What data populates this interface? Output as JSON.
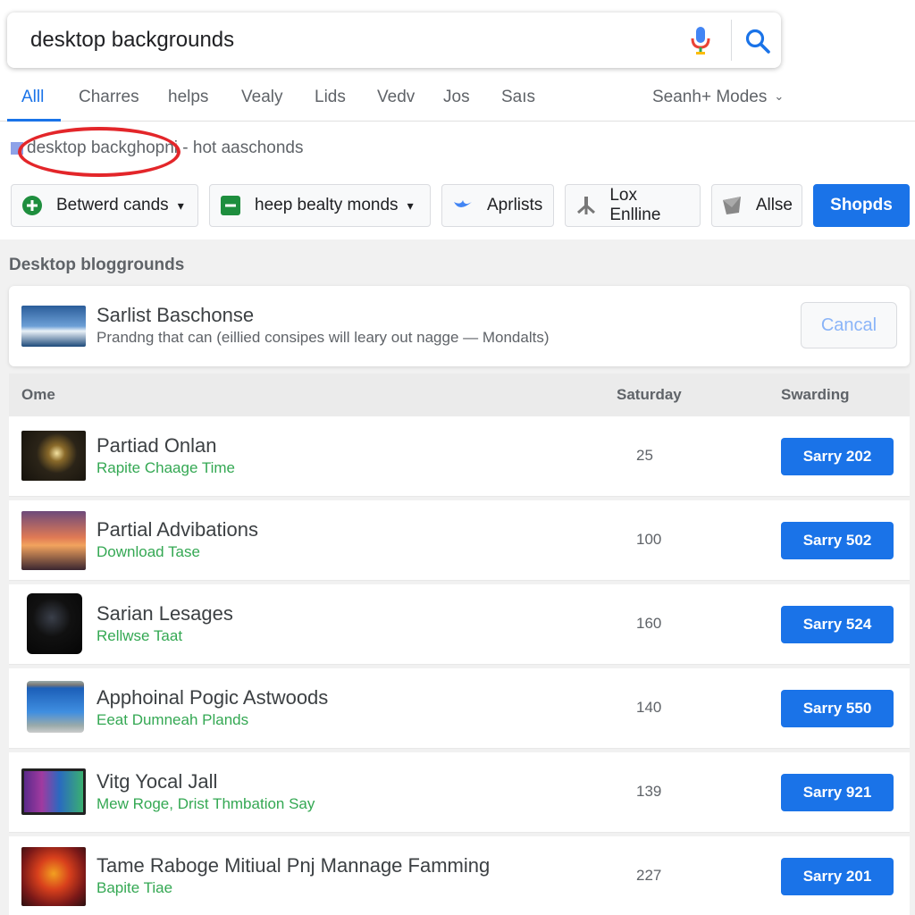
{
  "search": {
    "query": "desktop backgrounds",
    "mic_icon": "microphone-icon",
    "search_icon": "magnifier-icon"
  },
  "tabs": [
    {
      "label": "Alll",
      "active": true
    },
    {
      "label": "Charres"
    },
    {
      "label": "helps"
    },
    {
      "label": "Vealy"
    },
    {
      "label": "Lids"
    },
    {
      "label": "Vedv"
    },
    {
      "label": "Jos"
    },
    {
      "label": "Saıs"
    }
  ],
  "modes_label": "Seanh+ Modes",
  "suggestion": {
    "text": "desktop backghopni - hot aaschonds",
    "highlight_color": "#e3262a"
  },
  "chips": [
    {
      "label": "Betwerd cands",
      "icon": "plus-circle-icon",
      "dropdown": true
    },
    {
      "label": "heep bealty monds",
      "icon": "minus-square-icon",
      "dropdown": true
    },
    {
      "label": "Aprlists",
      "icon": "bird-icon"
    },
    {
      "label": "Lox Enlline",
      "icon": "tripod-icon"
    },
    {
      "label": "Allse",
      "icon": "flag-icon"
    },
    {
      "label": "Shopds",
      "primary": true
    }
  ],
  "section_title": "Desktop bloggrounds",
  "info_card": {
    "title": "Sarlist Baschonse",
    "subtitle": "Prandng that can (eillied consipes will leary out nagge — Mondalts)",
    "cancel_label": "Cancal"
  },
  "table": {
    "headers": [
      "Ome",
      "Saturday",
      "Swarding"
    ],
    "rows": [
      {
        "title": "Partiad Onlan",
        "subtitle": "Rapite Chaage Time",
        "value": "25",
        "button": "Sarry 202"
      },
      {
        "title": "Partial Advibations",
        "subtitle": "Download Tase",
        "value": "100",
        "button": "Sarry 502"
      },
      {
        "title": "Sarian Lesages",
        "subtitle": "Rellwse Taat",
        "value": "160",
        "button": "Sarry 524"
      },
      {
        "title": "Apphoinal Pogic Astwoods",
        "subtitle": "Eeat Dumneah Plands",
        "value": "140",
        "button": "Sarry 550"
      },
      {
        "title": "Vitg Yocal Jall",
        "subtitle": "Mew Roge, Drist Thmbation Say",
        "value": "139",
        "button": "Sarry 921"
      },
      {
        "title": "Tame Raboge Mitiual Pnj Mannage Famming",
        "subtitle": "Bapite Tiae",
        "value": "227",
        "button": "Sarry 201"
      }
    ]
  },
  "colors": {
    "accent": "#1a73e8",
    "subtitle_green": "#34a853"
  }
}
